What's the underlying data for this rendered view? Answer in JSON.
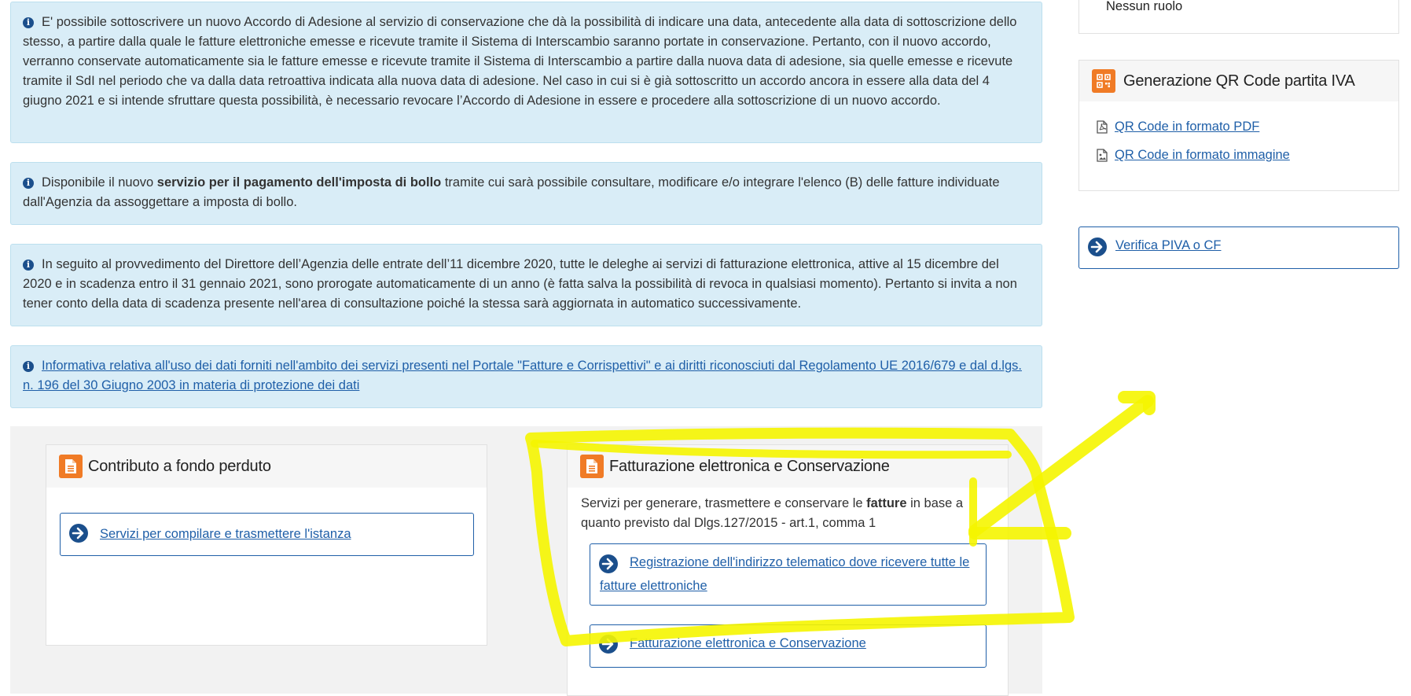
{
  "alerts": [
    {
      "text": "E' possibile sottoscrivere un nuovo Accordo di Adesione al servizio di conservazione che dà la possibilità di indicare una data, antecedente alla data di sottoscrizione dello stesso, a partire dalla quale le fatture elettroniche emesse e ricevute tramite il Sistema di Interscambio saranno portate in conservazione. Pertanto, con il nuovo accordo, verranno conservate automaticamente sia le fatture emesse e ricevute tramite il Sistema di Interscambio a partire dalla nuova data di adesione, sia quelle emesse e ricevute tramite il SdI nel periodo che va dalla data retroattiva indicata alla nuova data di adesione. Nel caso in cui si è già sottoscritto un accordo ancora in essere alla data del 4 giugno 2021 e si intende sfruttare questa possibilità, è necessario revocare l’Accordo di Adesione in essere e procedere alla sottoscrizione di un nuovo accordo."
    },
    {
      "before": "Disponibile il nuovo ",
      "bold": "servizio per il pagamento dell'imposta di bollo",
      "after": " tramite cui sarà possibile consultare, modificare e/o integrare l'elenco (B) delle fatture individuate dall'Agenzia da assoggettare a imposta di bollo."
    },
    {
      "text": "In seguito al provvedimento del Direttore dell’Agenzia delle entrate dell’11 dicembre 2020, tutte le deleghe ai servizi di fatturazione elettronica, attive al 15 dicembre del 2020 e in scadenza entro il 31 gennaio 2021, sono prorogate automaticamente di un anno (è fatta salva la possibilità di revoca in qualsiasi momento). Pertanto si invita a non tener conto della data di scadenza presente nell'area di consultazione poiché la stessa sarà aggiornata in automatico successivamente."
    },
    {
      "link": "Informativa relativa all'uso dei dati forniti nell'ambito dei servizi presenti nel Portale \"Fatture e Corrispettivi\" e ai diritti riconosciuti dal Regolamento UE 2016/679 e dal d.lgs. n. 196 del 30 Giugno 2003 in materia di protezione dei dati"
    }
  ],
  "cards": {
    "contributo": {
      "title": "Contributo a fondo perduto",
      "button": "Servizi per compilare e trasmettere l'istanza"
    },
    "fatturazione": {
      "title": "Fatturazione elettronica e Conservazione",
      "desc_before": "Servizi per generare, trasmettere e conservare le ",
      "desc_bold": "fatture",
      "desc_after": " in base a quanto previsto dal Dlgs.127/2015 - art.1, comma 1",
      "button1": "Registrazione dell'indirizzo telematico dove ricevere tutte le fatture elettroniche",
      "button2": "Fatturazione elettronica e Conservazione"
    }
  },
  "sidebar": {
    "role": "Nessun ruolo",
    "qr": {
      "title": "Generazione QR Code partita IVA",
      "pdf": "QR Code in formato PDF",
      "image": "QR Code in formato immagine"
    },
    "verifica": "Verifica PIVA o CF"
  },
  "colors": {
    "alert_bg": "#d9edf7",
    "link": "#1f5fa8",
    "icon_orange": "#f07b26",
    "highlight": "#f5f500"
  },
  "icons": [
    "info-icon",
    "document-icon",
    "arrow-right-circle-icon",
    "qr-code-icon",
    "pdf-file-icon",
    "image-file-icon"
  ]
}
